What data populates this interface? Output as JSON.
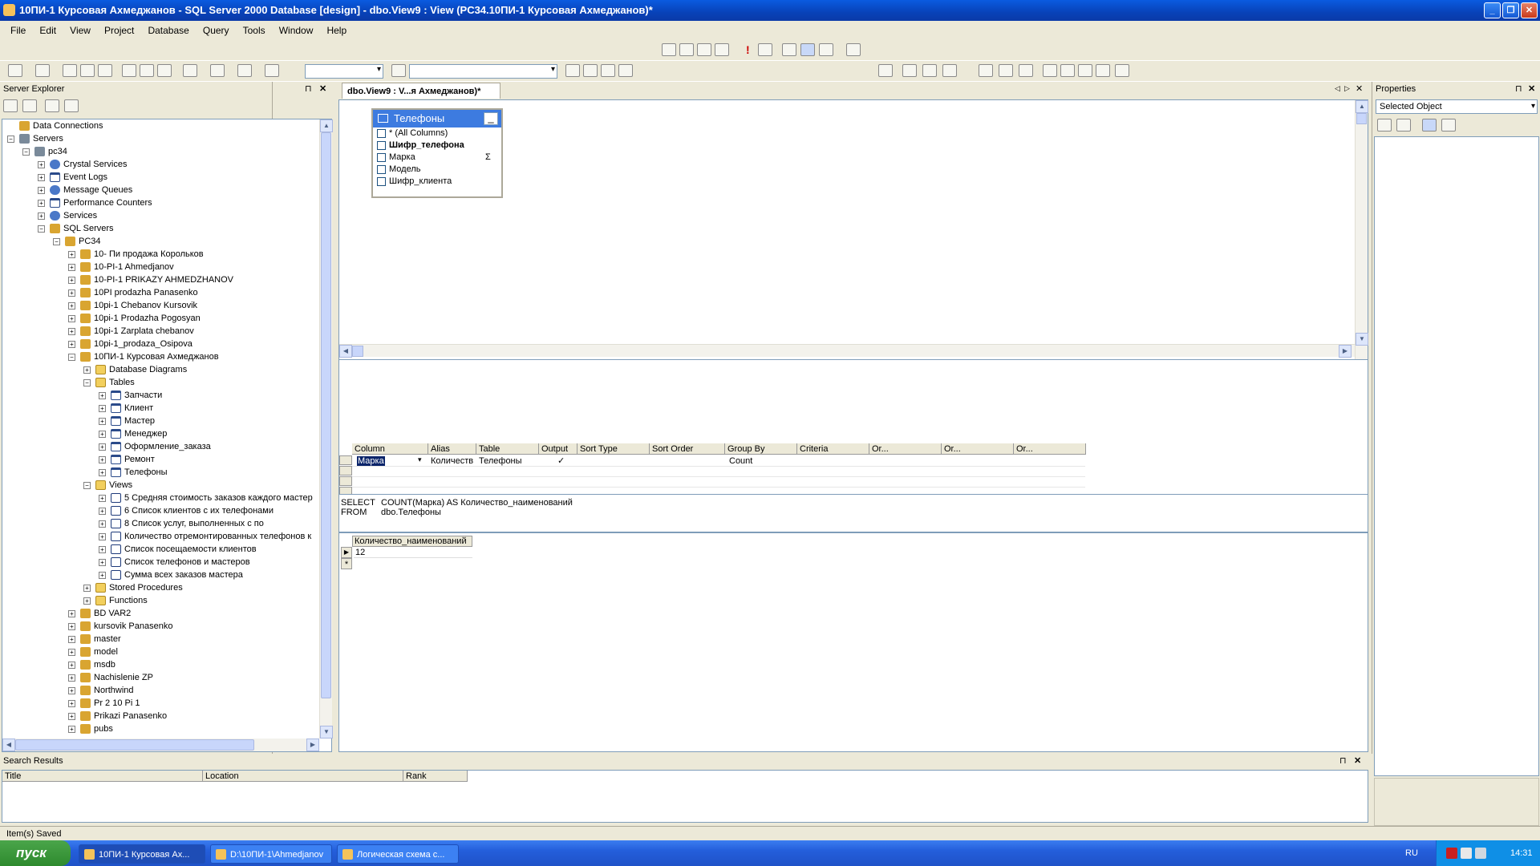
{
  "window": {
    "title": "10ПИ-1 Курсовая Ахмеджанов - SQL Server 2000 Database [design] - dbo.View9 : View (PC34.10ПИ-1 Курсовая Ахмеджанов)*"
  },
  "menu": [
    "File",
    "Edit",
    "View",
    "Project",
    "Database",
    "Query",
    "Tools",
    "Window",
    "Help"
  ],
  "server_explorer": {
    "title": "Server Explorer",
    "items": [
      {
        "label": "Data Connections",
        "indent": 0,
        "exp": "",
        "icon": "db"
      },
      {
        "label": "Servers",
        "indent": 0,
        "exp": "-",
        "icon": "srv"
      },
      {
        "label": "pc34",
        "indent": 1,
        "exp": "-",
        "icon": "srv"
      },
      {
        "label": "Crystal Services",
        "indent": 2,
        "exp": "+",
        "icon": "gear"
      },
      {
        "label": "Event Logs",
        "indent": 2,
        "exp": "+",
        "icon": "tbl"
      },
      {
        "label": "Message Queues",
        "indent": 2,
        "exp": "+",
        "icon": "gear"
      },
      {
        "label": "Performance Counters",
        "indent": 2,
        "exp": "+",
        "icon": "tbl"
      },
      {
        "label": "Services",
        "indent": 2,
        "exp": "+",
        "icon": "gear"
      },
      {
        "label": "SQL Servers",
        "indent": 2,
        "exp": "-",
        "icon": "db"
      },
      {
        "label": "PC34",
        "indent": 3,
        "exp": "-",
        "icon": "db"
      },
      {
        "label": "10- Пи продажа Корольков",
        "indent": 4,
        "exp": "+",
        "icon": "db"
      },
      {
        "label": "10-PI-1 Ahmedjanov",
        "indent": 4,
        "exp": "+",
        "icon": "db"
      },
      {
        "label": "10-PI-1 PRIKAZY AHMEDZHANOV",
        "indent": 4,
        "exp": "+",
        "icon": "db"
      },
      {
        "label": "10PI prodazha Panasenko",
        "indent": 4,
        "exp": "+",
        "icon": "db"
      },
      {
        "label": "10pi-1 Chebanov Kursovik",
        "indent": 4,
        "exp": "+",
        "icon": "db"
      },
      {
        "label": "10pi-1 Prodazha Pogosyan",
        "indent": 4,
        "exp": "+",
        "icon": "db"
      },
      {
        "label": "10pi-1 Zarplata chebanov",
        "indent": 4,
        "exp": "+",
        "icon": "db"
      },
      {
        "label": "10pi-1_prodaza_Osipova",
        "indent": 4,
        "exp": "+",
        "icon": "db"
      },
      {
        "label": "10ПИ-1 Курсовая Ахмеджанов",
        "indent": 4,
        "exp": "-",
        "icon": "db"
      },
      {
        "label": "Database Diagrams",
        "indent": 5,
        "exp": "+",
        "icon": "folder"
      },
      {
        "label": "Tables",
        "indent": 5,
        "exp": "-",
        "icon": "folder"
      },
      {
        "label": "Запчасти",
        "indent": 6,
        "exp": "+",
        "icon": "tbl"
      },
      {
        "label": "Клиент",
        "indent": 6,
        "exp": "+",
        "icon": "tbl"
      },
      {
        "label": "Мастер",
        "indent": 6,
        "exp": "+",
        "icon": "tbl"
      },
      {
        "label": "Менеджер",
        "indent": 6,
        "exp": "+",
        "icon": "tbl"
      },
      {
        "label": "Оформление_заказа",
        "indent": 6,
        "exp": "+",
        "icon": "tbl"
      },
      {
        "label": "Ремонт",
        "indent": 6,
        "exp": "+",
        "icon": "tbl"
      },
      {
        "label": "Телефоны",
        "indent": 6,
        "exp": "+",
        "icon": "tbl"
      },
      {
        "label": "Views",
        "indent": 5,
        "exp": "-",
        "icon": "folder"
      },
      {
        "label": "5 Средняя стоимость заказов каждого мастер",
        "indent": 6,
        "exp": "+",
        "icon": "view"
      },
      {
        "label": "6 Список клиентов с их телефонами",
        "indent": 6,
        "exp": "+",
        "icon": "view"
      },
      {
        "label": "8 Список услуг, выполненных  с по",
        "indent": 6,
        "exp": "+",
        "icon": "view"
      },
      {
        "label": "Количество отремонтированных телефонов к",
        "indent": 6,
        "exp": "+",
        "icon": "view"
      },
      {
        "label": "Список посещаемости клиентов",
        "indent": 6,
        "exp": "+",
        "icon": "view"
      },
      {
        "label": "Список телефонов и мастеров",
        "indent": 6,
        "exp": "+",
        "icon": "view"
      },
      {
        "label": "Сумма всех заказов мастера",
        "indent": 6,
        "exp": "+",
        "icon": "view"
      },
      {
        "label": "Stored Procedures",
        "indent": 5,
        "exp": "+",
        "icon": "folder"
      },
      {
        "label": "Functions",
        "indent": 5,
        "exp": "+",
        "icon": "folder"
      },
      {
        "label": "BD VAR2",
        "indent": 4,
        "exp": "+",
        "icon": "db"
      },
      {
        "label": "kursovik Panasenko",
        "indent": 4,
        "exp": "+",
        "icon": "db"
      },
      {
        "label": "master",
        "indent": 4,
        "exp": "+",
        "icon": "db"
      },
      {
        "label": "model",
        "indent": 4,
        "exp": "+",
        "icon": "db"
      },
      {
        "label": "msdb",
        "indent": 4,
        "exp": "+",
        "icon": "db"
      },
      {
        "label": "Nachislenie ZP",
        "indent": 4,
        "exp": "+",
        "icon": "db"
      },
      {
        "label": "Northwind",
        "indent": 4,
        "exp": "+",
        "icon": "db"
      },
      {
        "label": "Pr 2 10 Pi 1",
        "indent": 4,
        "exp": "+",
        "icon": "db"
      },
      {
        "label": "Prikazi  Panasenko",
        "indent": 4,
        "exp": "+",
        "icon": "db"
      },
      {
        "label": "pubs",
        "indent": 4,
        "exp": "+",
        "icon": "db"
      }
    ]
  },
  "doc_tab": {
    "label": "dbo.View9 : V...я Ахмеджанов)*"
  },
  "table_box": {
    "title": "Телефоны",
    "columns": [
      {
        "label": "* (All Columns)",
        "bold": false,
        "sigma": ""
      },
      {
        "label": "Шифр_телефона",
        "bold": true,
        "sigma": ""
      },
      {
        "label": "Марка",
        "bold": false,
        "sigma": "Σ"
      },
      {
        "label": "Модель",
        "bold": false,
        "sigma": ""
      },
      {
        "label": "Шифр_клиента",
        "bold": false,
        "sigma": ""
      }
    ]
  },
  "grid": {
    "headers": [
      "Column",
      "Alias",
      "Table",
      "Output",
      "Sort Type",
      "Sort Order",
      "Group By",
      "Criteria",
      "Or...",
      "Or...",
      "Or..."
    ],
    "row": {
      "column": "Марка",
      "alias": "Количеств",
      "table": "Телефоны",
      "output": "✓",
      "group_by": "Count"
    }
  },
  "sql": {
    "line1_kw": "SELECT",
    "line1": "COUNT(Марка) AS Количество_наименований",
    "line2_kw": "FROM",
    "line2": "dbo.Телефоны"
  },
  "results": {
    "header": "Количество_наименований",
    "value": "12",
    "new_row": "*"
  },
  "properties": {
    "title": "Properties",
    "selected": "Selected Object"
  },
  "search": {
    "title": "Search Results",
    "cols": [
      "Title",
      "Location",
      "Rank"
    ]
  },
  "status": {
    "text": "Item(s) Saved"
  },
  "taskbar": {
    "start": "пуск",
    "tasks": [
      "10ПИ-1 Курсовая Ах...",
      "D:\\10ПИ-1\\Ahmedjanov",
      "Логическая схема с..."
    ],
    "lang": "RU",
    "time": "14:31"
  }
}
